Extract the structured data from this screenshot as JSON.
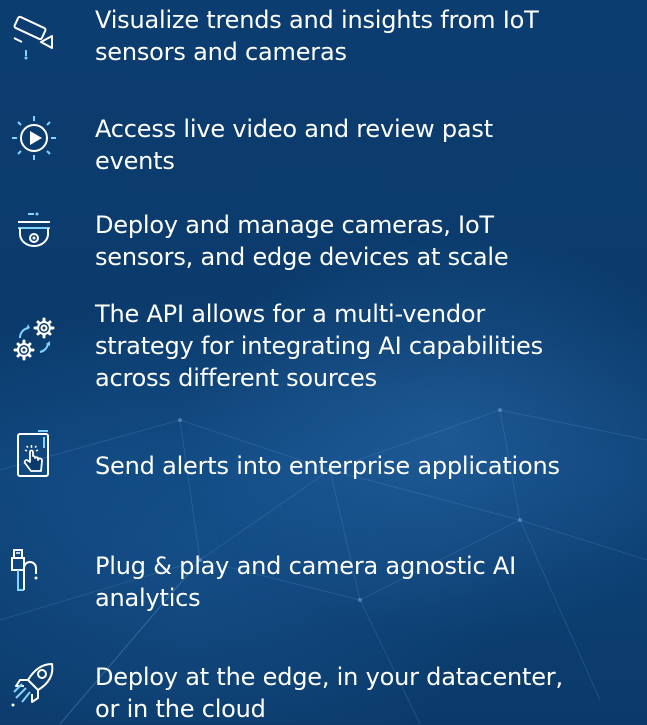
{
  "features": [
    {
      "icon": "security-camera-icon",
      "text": "Visualize trends and insights from IoT\nsensors and cameras"
    },
    {
      "icon": "live-video-play-icon",
      "text": "Access live video and review past\nevents"
    },
    {
      "icon": "dome-camera-icon",
      "text": "Deploy and manage cameras, IoT\nsensors, and edge devices at scale"
    },
    {
      "icon": "gears-sync-icon",
      "text": "The API allows for a  multi-vendor\nstrategy for integrating AI capabilities\nacross different sources"
    },
    {
      "icon": "mobile-touch-icon",
      "text": "Send alerts into enterprise applications"
    },
    {
      "icon": "usb-plug-icon",
      "text": "Plug & play and camera agnostic AI\nanalytics"
    },
    {
      "icon": "rocket-icon",
      "text": "Deploy at the edge, in your datacenter,\nor in the cloud"
    }
  ],
  "colors": {
    "background": "#0b3a6b",
    "text": "#ffffff",
    "icon_accent": "#7fd3ff"
  }
}
